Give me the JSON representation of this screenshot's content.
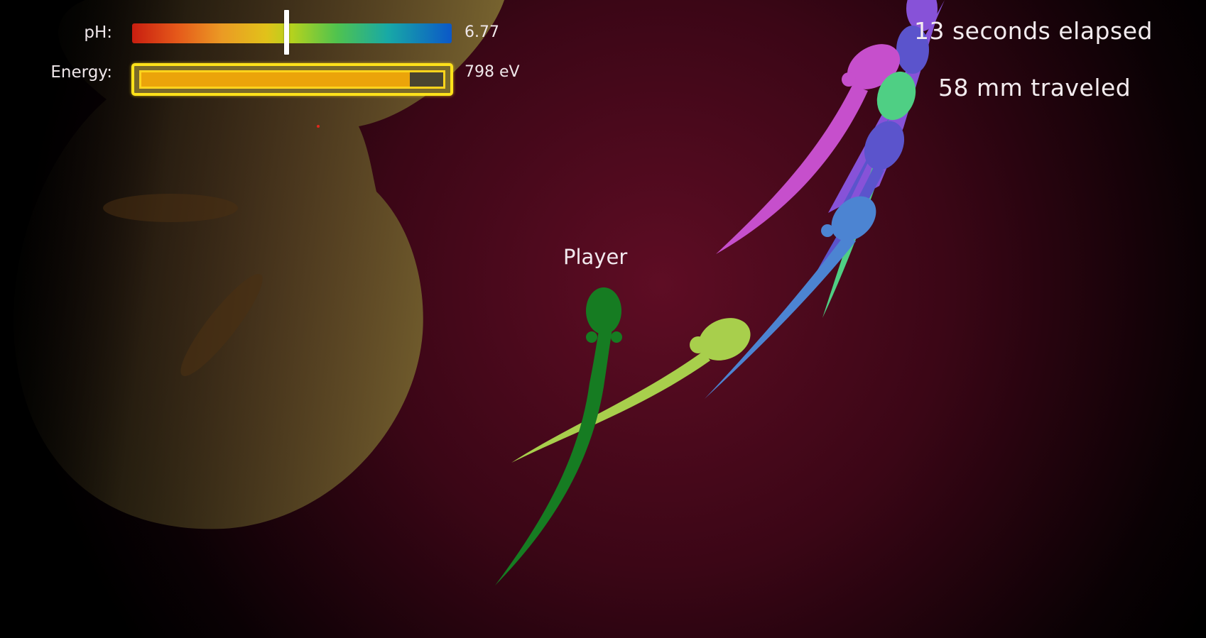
{
  "hud": {
    "ph": {
      "label": "pH:",
      "value": "6.77",
      "level": 6.77
    },
    "energy": {
      "label": "Energy:",
      "value": "798 eV",
      "fraction": 0.89
    }
  },
  "stats": {
    "elapsed": "13 seconds elapsed",
    "traveled": "58 mm traveled"
  },
  "player": {
    "label": "Player",
    "color": "#167c22"
  },
  "colors": {
    "background_center": "#5e0d24",
    "background_edge": "#000000",
    "cell": "#7a6630",
    "energy_border": "#ffe21a",
    "energy_fill": "#eba40a"
  },
  "sperm_colors": {
    "player": "#167c22",
    "lime": "#a8cf4c",
    "magenta": "#c64fcc",
    "violet": "#8752d8",
    "indigo": "#5b54cc",
    "mint": "#4fcf84",
    "blue": "#4c84d2"
  }
}
